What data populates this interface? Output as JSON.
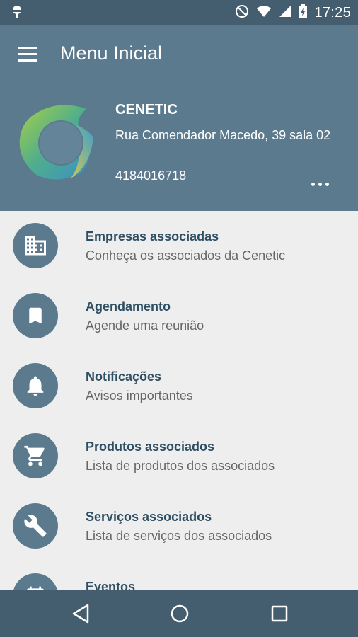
{
  "status": {
    "time": "17:25"
  },
  "header": {
    "title": "Menu Inicial"
  },
  "org": {
    "name": "CENETIC",
    "address": "Rua Comendador Macedo, 39 sala 02",
    "phone": "4184016718"
  },
  "menu": [
    {
      "title": "Empresas associadas",
      "subtitle": "Conheça os associados da Cenetic",
      "icon": "building-icon"
    },
    {
      "title": "Agendamento",
      "subtitle": "Agende uma reunião",
      "icon": "bookmark-icon"
    },
    {
      "title": "Notificações",
      "subtitle": "Avisos importantes",
      "icon": "bell-icon"
    },
    {
      "title": "Produtos associados",
      "subtitle": "Lista de produtos dos associados",
      "icon": "cart-icon"
    },
    {
      "title": "Serviços associados",
      "subtitle": "Lista de serviços dos associados",
      "icon": "wrench-icon"
    },
    {
      "title": "Eventos",
      "subtitle": "",
      "icon": "calendar-icon"
    }
  ],
  "colors": {
    "statusbar": "#445e70",
    "appbar": "#5b7a8e",
    "list_bg": "#eeeeee",
    "item_title": "#2e4e63"
  }
}
